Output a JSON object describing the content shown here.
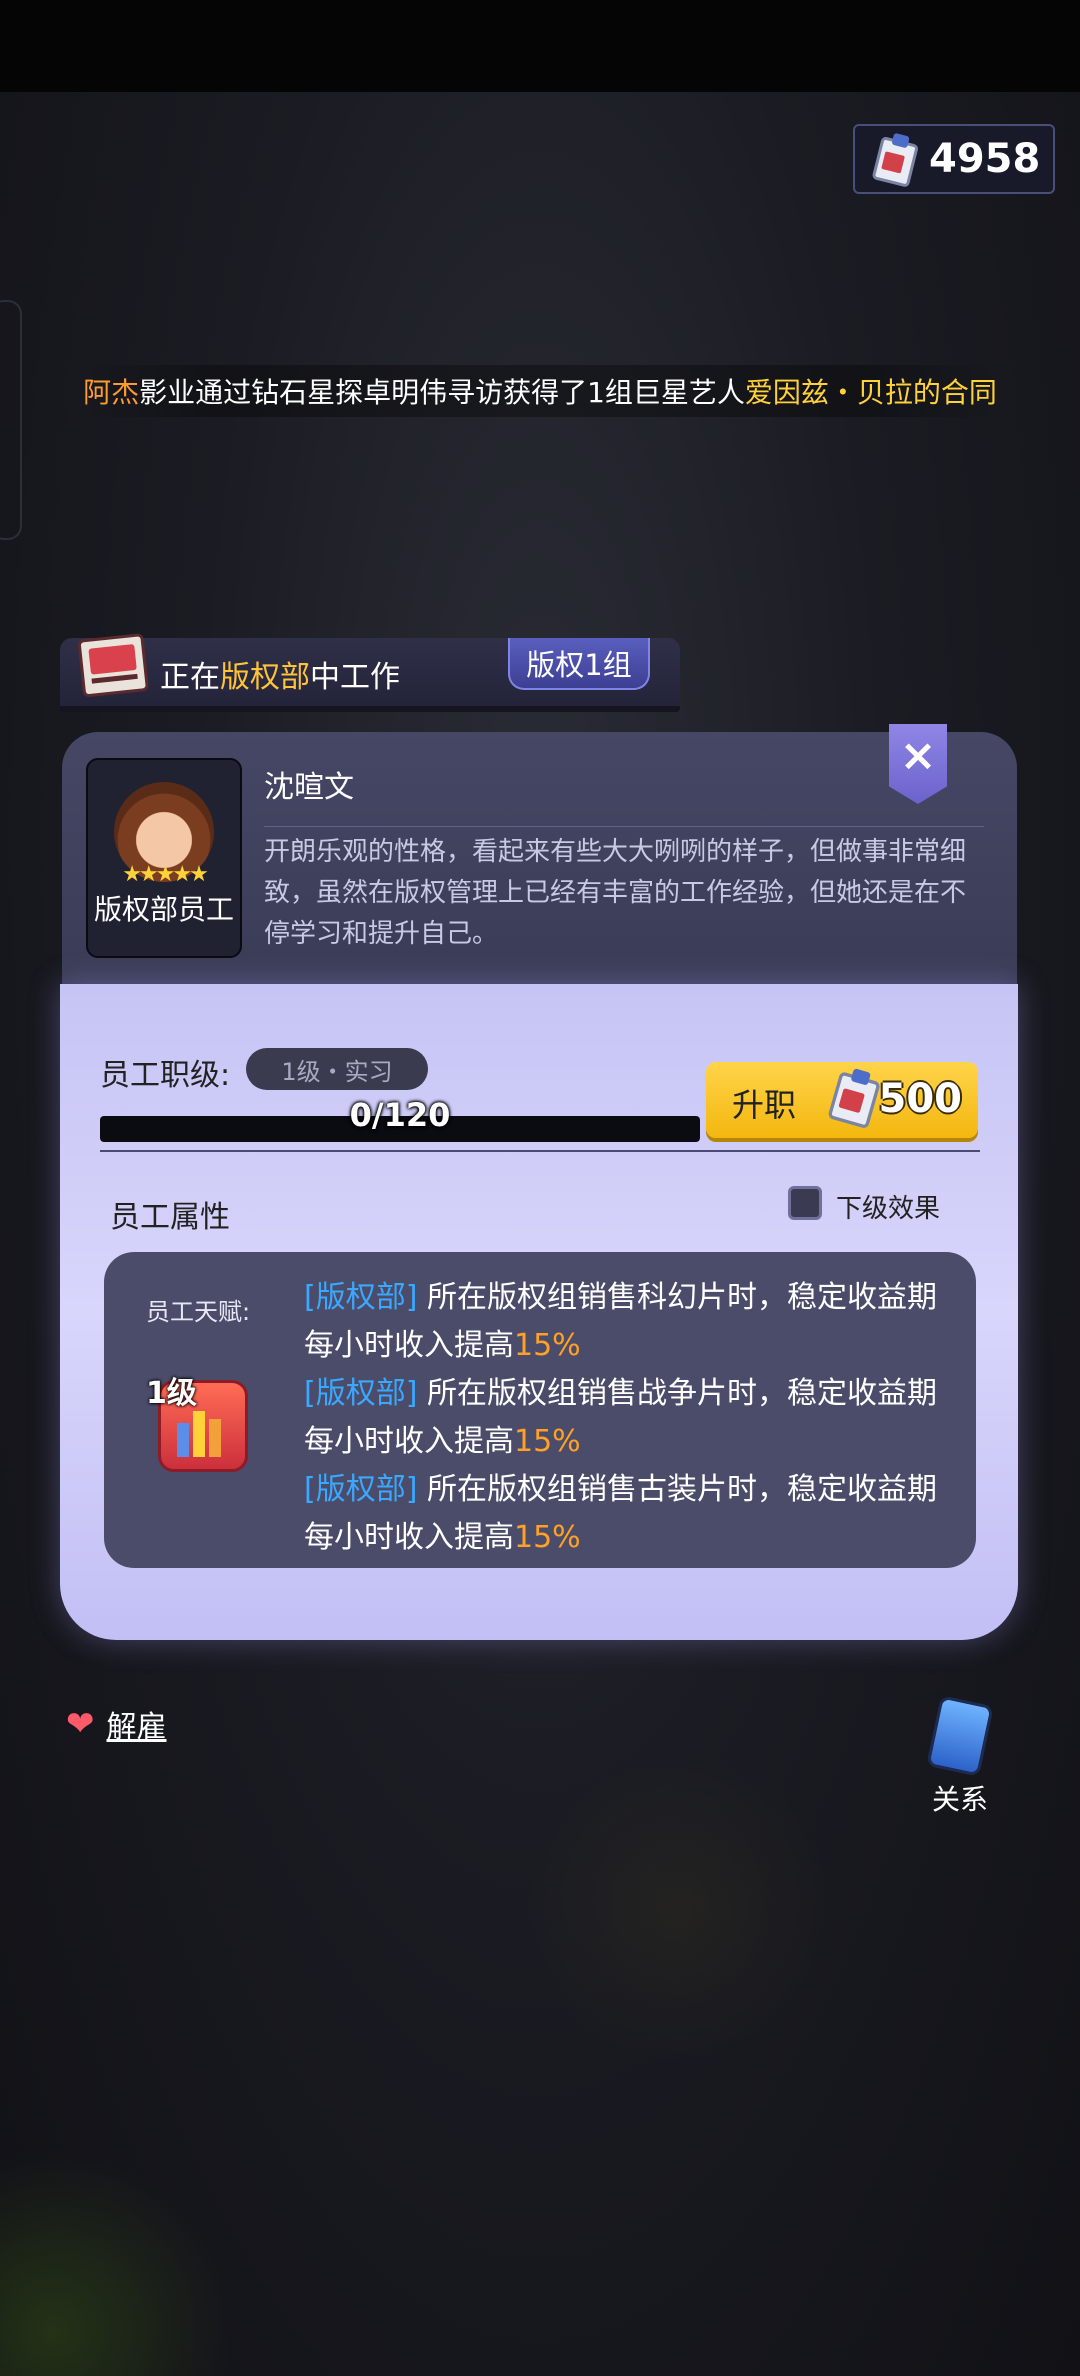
{
  "currency": {
    "icon": "clipboard-contract-icon",
    "value": "4958"
  },
  "ticker": {
    "part1": "阿杰",
    "part2": "影业通过钻石星探卓明伟寻访获得了1组巨星艺人",
    "part3": "爱因兹・贝拉的合同"
  },
  "work": {
    "prefix": "正在",
    "department": "版权部",
    "suffix": "中工作",
    "group": "版权1组"
  },
  "employee": {
    "name": "沈暄文",
    "stars": "★★★★★",
    "star_count": 5,
    "role": "版权部员工",
    "description": "开朗乐观的性格，看起来有些大大咧咧的样子，但做事非常细致，虽然在版权管理上已经有丰富的工作经验，但她还是在不停学习和提升自己。",
    "close_symbol": "×"
  },
  "level": {
    "label": "员工职级:",
    "value": "1级・实习",
    "progress_text": "0/120",
    "progress": 0,
    "promote_label": "升职",
    "promote_cost": "500"
  },
  "attributes": {
    "title": "员工属性",
    "lower_effect_label": "下级效果",
    "lower_effect_checked": false,
    "talent_label": "员工天赋:",
    "talent_level": "1级",
    "talents": [
      {
        "dept": "[版权部]",
        "text": " 所在版权组销售科幻片时，稳定收益期每小时收入提高",
        "pct": "15%"
      },
      {
        "dept": "[版权部]",
        "text": " 所在版权组销售战争片时，稳定收益期每小时收入提高",
        "pct": "15%"
      },
      {
        "dept": "[版权部]",
        "text": " 所在版权组销售古装片时，稳定收益期每小时收入提高",
        "pct": "15%"
      }
    ]
  },
  "actions": {
    "fire_label": "解雇",
    "relation_label": "关系"
  },
  "colors": {
    "highlight_orange": "#ff9a2e",
    "highlight_yellow": "#ffd23a",
    "dept_blue": "#3aa8ff",
    "percent_orange": "#ffa126",
    "promote_gold": "#ffd44a"
  }
}
